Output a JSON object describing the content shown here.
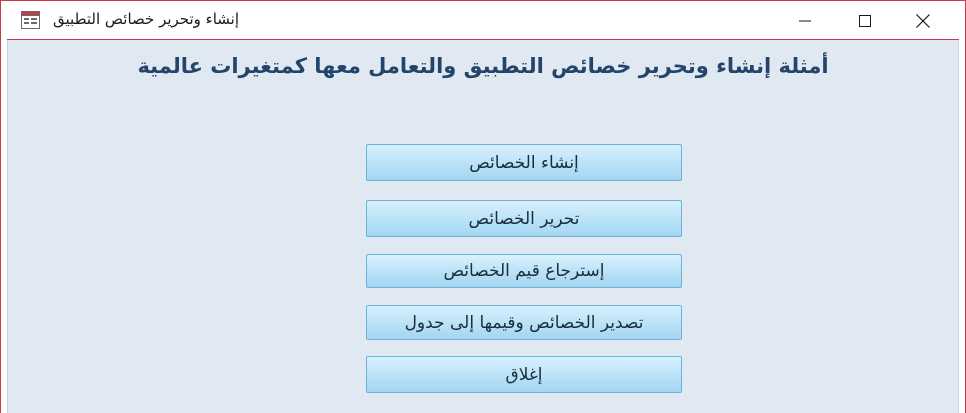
{
  "window": {
    "title": "إنشاء وتحرير خصائص التطبيق"
  },
  "main": {
    "heading": "أمثلة إنشاء وتحرير خصائص التطبيق والتعامل معها كمتغيرات عالمية",
    "buttons": [
      {
        "label": "إنشاء الخصائص"
      },
      {
        "label": "تحرير الخصائص"
      },
      {
        "label": "إسترجاع قيم الخصائص"
      },
      {
        "label": "تصدير الخصائص وقيمها إلى جدول"
      },
      {
        "label": "إغلاق"
      }
    ]
  },
  "colors": {
    "window_border": "#c43b4a",
    "background": "#e0e8f1",
    "heading": "#23456b",
    "button_fill": "#b9e2f7",
    "button_border": "#6fb2dc"
  }
}
